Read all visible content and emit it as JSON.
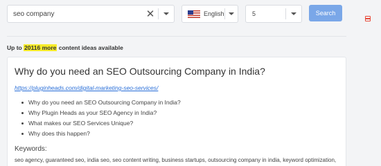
{
  "search": {
    "query": "seo company"
  },
  "language": {
    "selected": "English"
  },
  "count": {
    "selected": "5"
  },
  "search_button": "Search",
  "ideas": {
    "prefix": "Up to ",
    "highlight": "20116 more",
    "suffix": " content ideas available"
  },
  "card": {
    "title": "Why do you need an SEO Outsourcing Company in India?",
    "url": "https://pluginheads.com/digital-marketing-seo-services/",
    "bullets": [
      "Why do you need an SEO Outsourcing Company in India?",
      "Why Plugin Heads as your SEO Agency in India?",
      "What makes our SEO Services Unique?",
      "Why does this happen?"
    ],
    "keywords_heading": "Keywords:",
    "keywords_text": "seo agency,  guaranteed seo,  india seo,  seo content writing,  business startups,  outsourcing company in india,  keyword optimization,  seo content writing services,  clogged up,  too much stuff,  relevant keywords,  find it easy,"
  },
  "icons": {
    "clear": "close-icon",
    "caret": "chevron-down-icon",
    "flag": "us-flag-icon",
    "side": "bookmark-icon"
  }
}
